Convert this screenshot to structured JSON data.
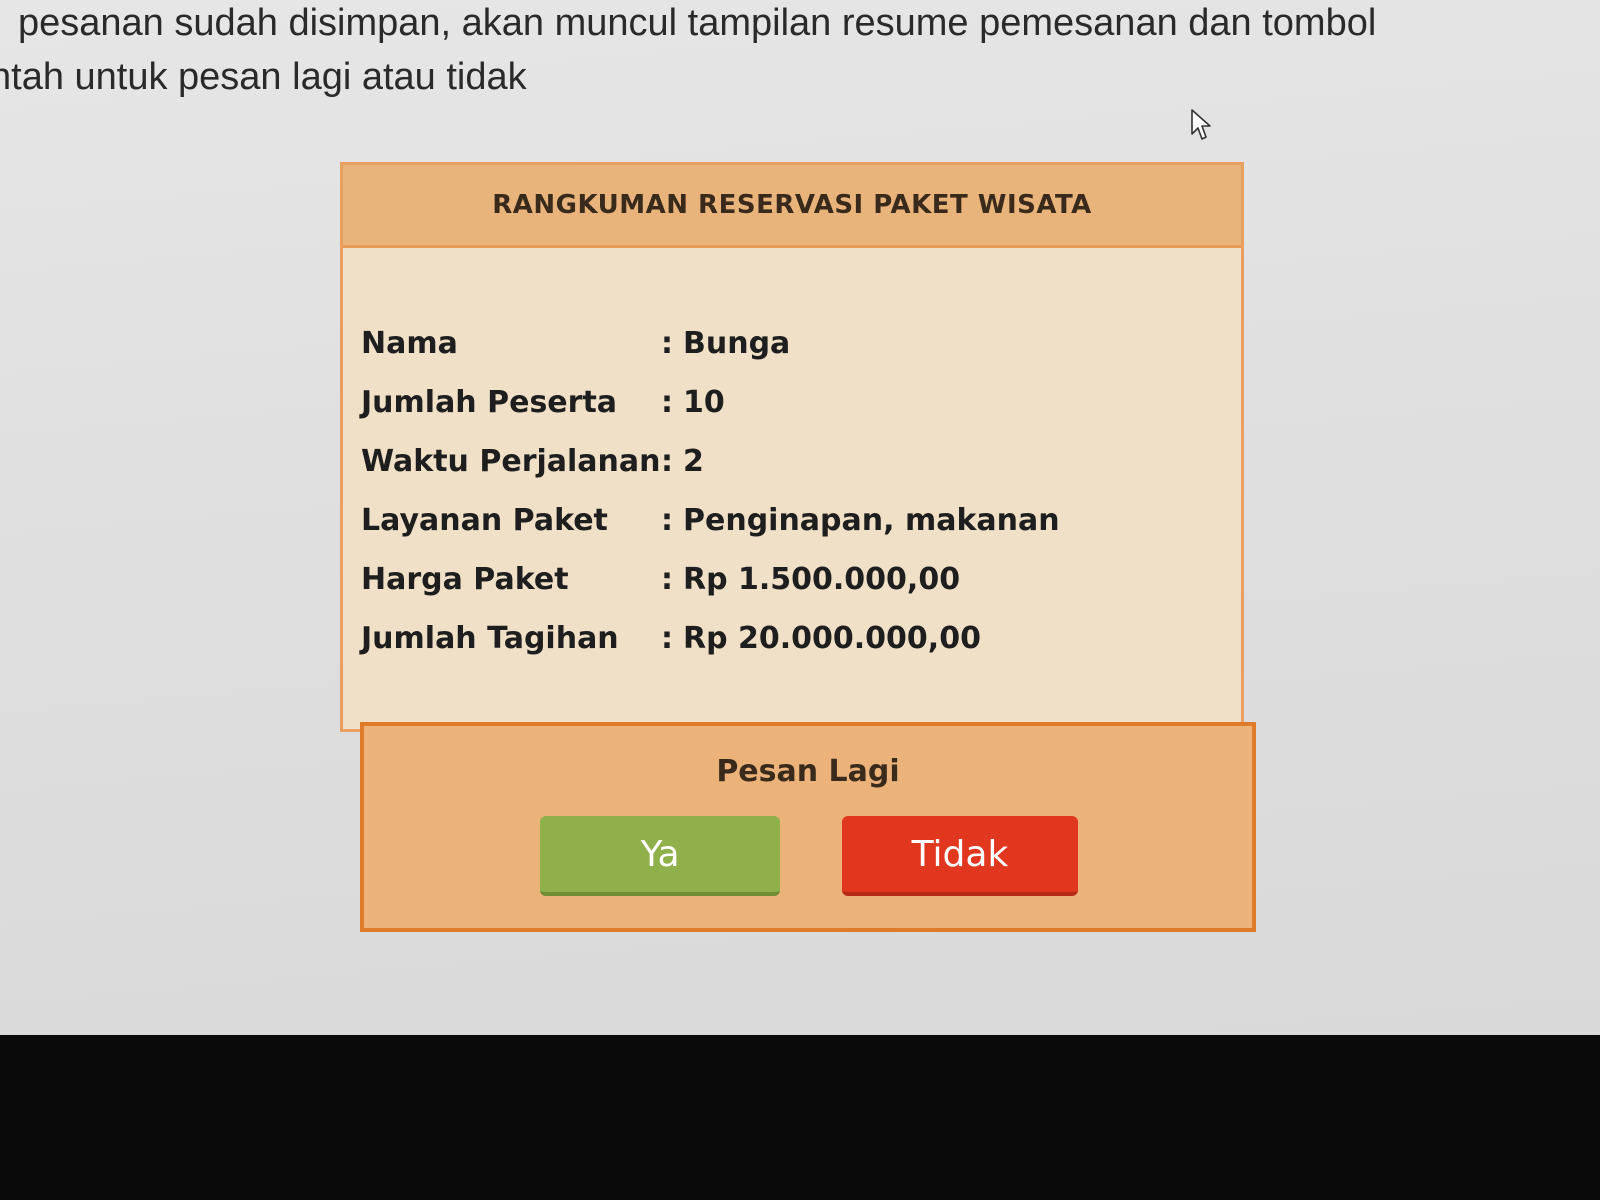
{
  "document": {
    "line1": "pesanan sudah disimpan, akan muncul tampilan resume pemesanan dan tombol",
    "line2": "ntah untuk pesan lagi atau tidak"
  },
  "summary": {
    "title": "RANGKUMAN RESERVASI PAKET WISATA",
    "separator": ":",
    "rows": [
      {
        "label": "Nama",
        "value": "Bunga"
      },
      {
        "label": "Jumlah Peserta",
        "value": "10"
      },
      {
        "label": "Waktu Perjalanan",
        "value": "2"
      },
      {
        "label": "Layanan Paket",
        "value": "Penginapan, makanan"
      },
      {
        "label": "Harga Paket",
        "value": "Rp 1.500.000,00"
      },
      {
        "label": "Jumlah Tagihan",
        "value": "Rp 20.000.000,00"
      }
    ]
  },
  "confirm": {
    "title": "Pesan Lagi",
    "yes_label": "Ya",
    "no_label": "Tidak"
  },
  "colors": {
    "header_bg": "#e9b47b",
    "panel_bg": "#efe0c7",
    "confirm_bg": "#ebb27a",
    "border": "#de7c2a",
    "yes_button": "#8fb04a",
    "no_button": "#e2371f"
  },
  "icons": {
    "cursor": "mouse-pointer-icon"
  }
}
